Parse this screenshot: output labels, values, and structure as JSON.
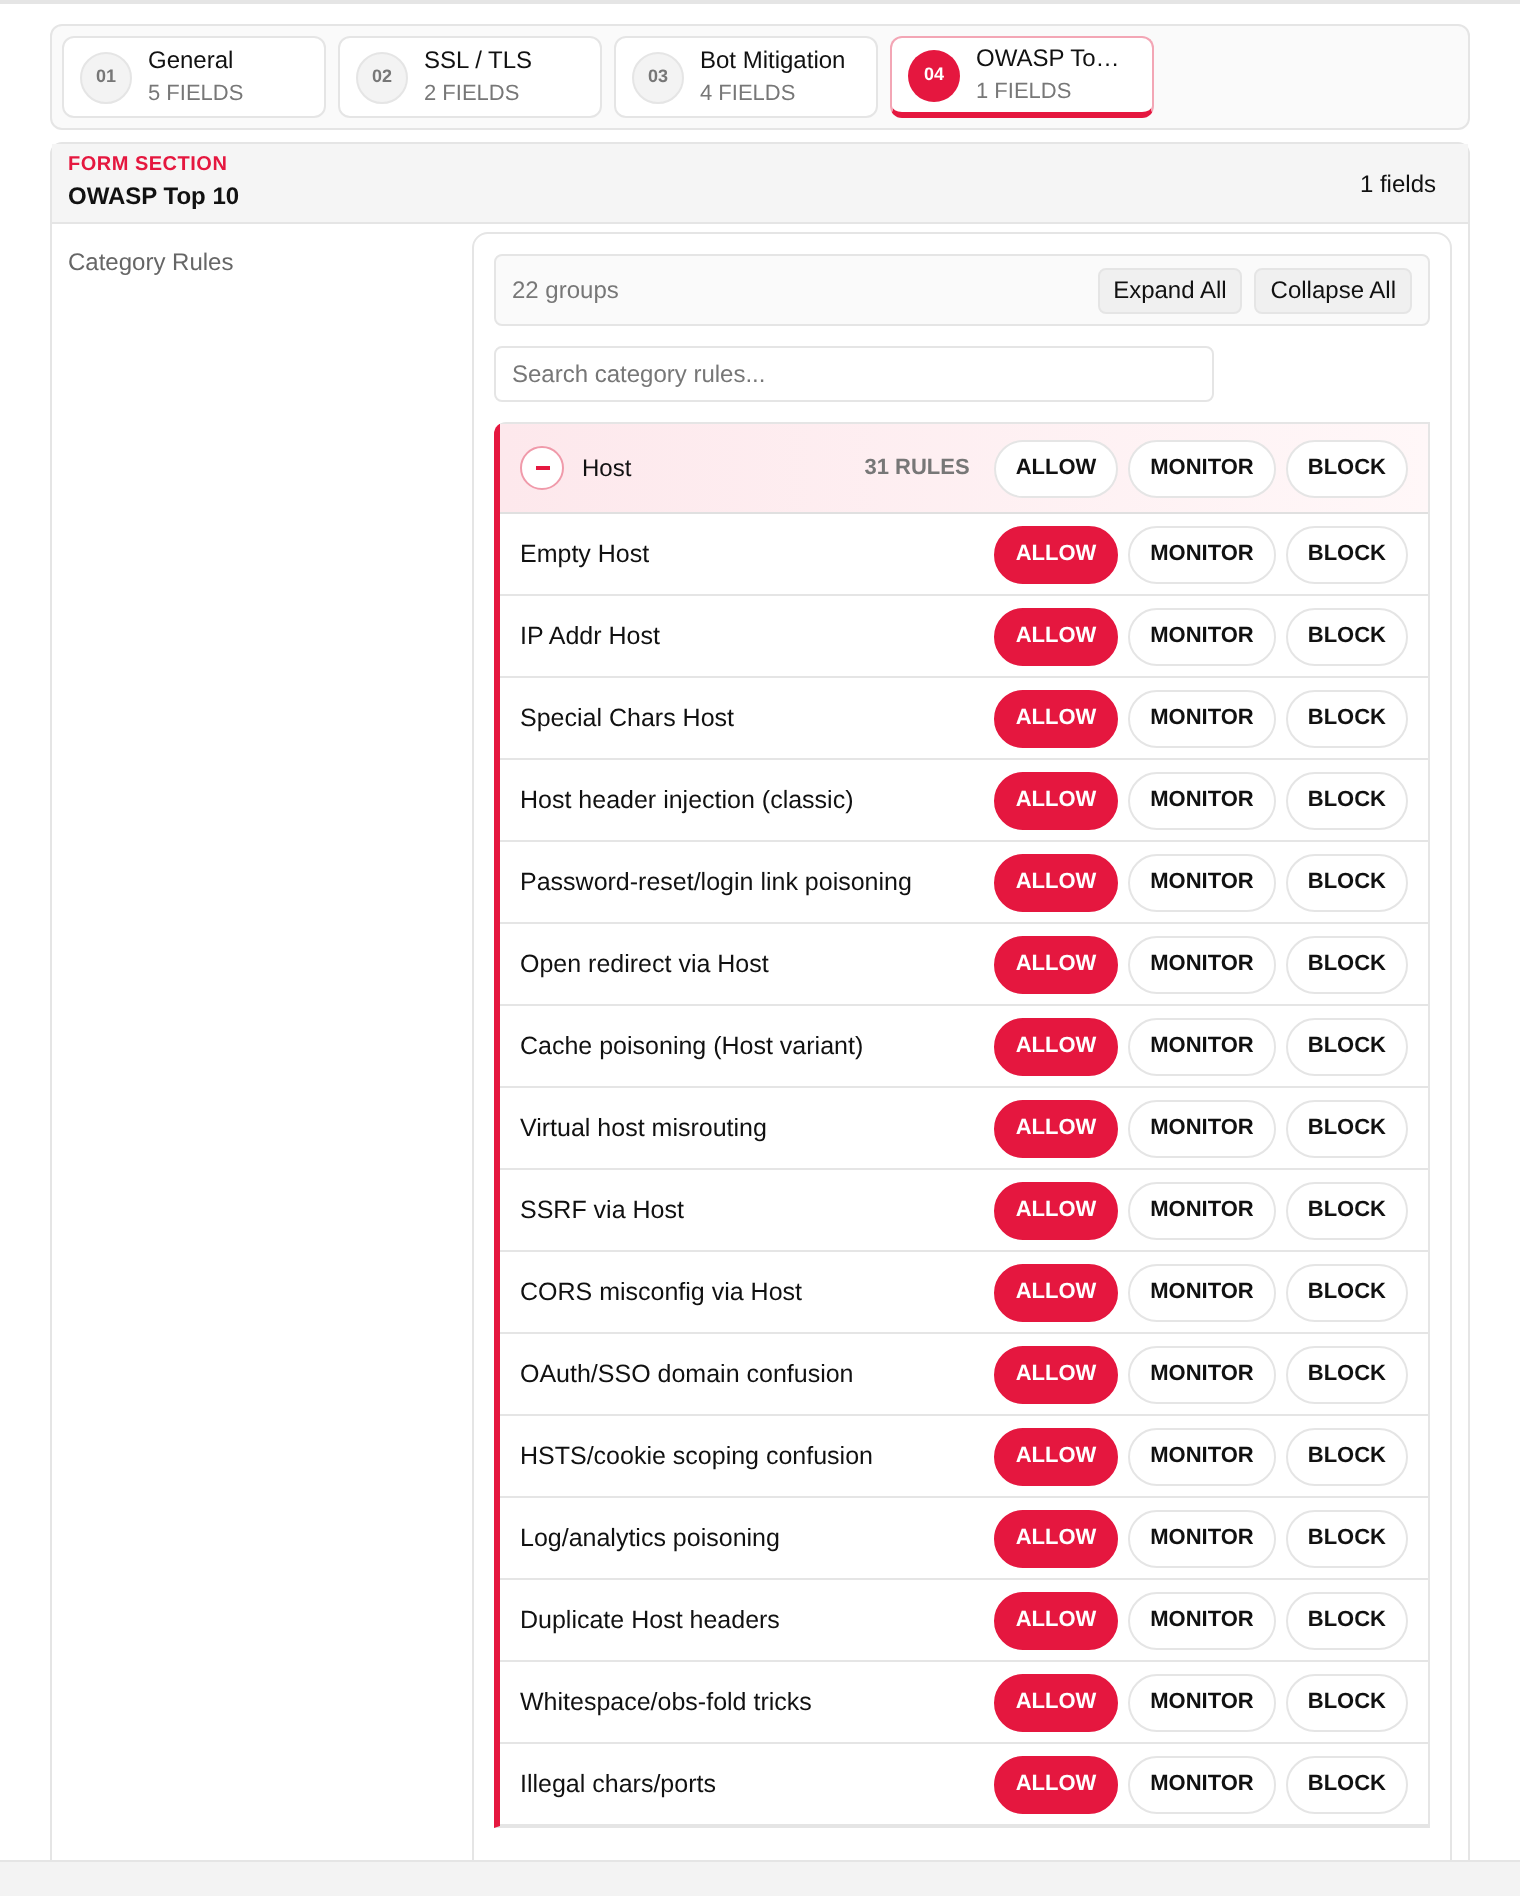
{
  "steps": [
    {
      "number": "01",
      "title": "General",
      "subtitle": "5 FIELDS",
      "selected": false
    },
    {
      "number": "02",
      "title": "SSL / TLS",
      "subtitle": "2 FIELDS",
      "selected": false
    },
    {
      "number": "03",
      "title": "Bot Mitigation",
      "subtitle": "4 FIELDS",
      "selected": false
    },
    {
      "number": "04",
      "title": "OWASP To…",
      "subtitle": "1 FIELDS",
      "selected": true
    }
  ],
  "section": {
    "eyebrow": "FORM SECTION",
    "title": "OWASP Top 10",
    "count": "1 fields",
    "field_label": "Category Rules",
    "toolbar": {
      "summary": "22 groups",
      "buttons": [
        "Expand All",
        "Collapse All"
      ]
    },
    "search": {
      "placeholder": "Search category rules..."
    },
    "group": {
      "name": "Host",
      "expanded": true,
      "count": "31 RULES",
      "actions": [
        {
          "label": "ALLOW",
          "selected": false
        },
        {
          "label": "MONITOR",
          "selected": false
        },
        {
          "label": "BLOCK",
          "selected": false
        }
      ],
      "rules": [
        {
          "name": "Empty Host",
          "actions": [
            {
              "label": "ALLOW",
              "selected": true
            },
            {
              "label": "MONITOR",
              "selected": false
            },
            {
              "label": "BLOCK",
              "selected": false
            }
          ]
        },
        {
          "name": "IP Addr Host",
          "actions": [
            {
              "label": "ALLOW",
              "selected": true
            },
            {
              "label": "MONITOR",
              "selected": false
            },
            {
              "label": "BLOCK",
              "selected": false
            }
          ]
        },
        {
          "name": "Special Chars Host",
          "actions": [
            {
              "label": "ALLOW",
              "selected": true
            },
            {
              "label": "MONITOR",
              "selected": false
            },
            {
              "label": "BLOCK",
              "selected": false
            }
          ]
        },
        {
          "name": "Host header injection (classic)",
          "actions": [
            {
              "label": "ALLOW",
              "selected": true
            },
            {
              "label": "MONITOR",
              "selected": false
            },
            {
              "label": "BLOCK",
              "selected": false
            }
          ]
        },
        {
          "name": "Password-reset/login link poisoning",
          "actions": [
            {
              "label": "ALLOW",
              "selected": true
            },
            {
              "label": "MONITOR",
              "selected": false
            },
            {
              "label": "BLOCK",
              "selected": false
            }
          ]
        },
        {
          "name": "Open redirect via Host",
          "actions": [
            {
              "label": "ALLOW",
              "selected": true
            },
            {
              "label": "MONITOR",
              "selected": false
            },
            {
              "label": "BLOCK",
              "selected": false
            }
          ]
        },
        {
          "name": "Cache poisoning (Host variant)",
          "actions": [
            {
              "label": "ALLOW",
              "selected": true
            },
            {
              "label": "MONITOR",
              "selected": false
            },
            {
              "label": "BLOCK",
              "selected": false
            }
          ]
        },
        {
          "name": "Virtual host misrouting",
          "actions": [
            {
              "label": "ALLOW",
              "selected": true
            },
            {
              "label": "MONITOR",
              "selected": false
            },
            {
              "label": "BLOCK",
              "selected": false
            }
          ]
        },
        {
          "name": "SSRF via Host",
          "actions": [
            {
              "label": "ALLOW",
              "selected": true
            },
            {
              "label": "MONITOR",
              "selected": false
            },
            {
              "label": "BLOCK",
              "selected": false
            }
          ]
        },
        {
          "name": "CORS misconfig via Host",
          "actions": [
            {
              "label": "ALLOW",
              "selected": true
            },
            {
              "label": "MONITOR",
              "selected": false
            },
            {
              "label": "BLOCK",
              "selected": false
            }
          ]
        },
        {
          "name": "OAuth/SSO domain confusion",
          "actions": [
            {
              "label": "ALLOW",
              "selected": true
            },
            {
              "label": "MONITOR",
              "selected": false
            },
            {
              "label": "BLOCK",
              "selected": false
            }
          ]
        },
        {
          "name": "HSTS/cookie scoping confusion",
          "actions": [
            {
              "label": "ALLOW",
              "selected": true
            },
            {
              "label": "MONITOR",
              "selected": false
            },
            {
              "label": "BLOCK",
              "selected": false
            }
          ]
        },
        {
          "name": "Log/analytics poisoning",
          "actions": [
            {
              "label": "ALLOW",
              "selected": true
            },
            {
              "label": "MONITOR",
              "selected": false
            },
            {
              "label": "BLOCK",
              "selected": false
            }
          ]
        },
        {
          "name": "Duplicate Host headers",
          "actions": [
            {
              "label": "ALLOW",
              "selected": true
            },
            {
              "label": "MONITOR",
              "selected": false
            },
            {
              "label": "BLOCK",
              "selected": false
            }
          ]
        },
        {
          "name": "Whitespace/obs-fold tricks",
          "actions": [
            {
              "label": "ALLOW",
              "selected": true
            },
            {
              "label": "MONITOR",
              "selected": false
            },
            {
              "label": "BLOCK",
              "selected": false
            }
          ]
        },
        {
          "name": "Illegal chars/ports",
          "actions": [
            {
              "label": "ALLOW",
              "selected": true
            },
            {
              "label": "MONITOR",
              "selected": false
            },
            {
              "label": "BLOCK",
              "selected": false
            }
          ]
        }
      ]
    }
  }
}
